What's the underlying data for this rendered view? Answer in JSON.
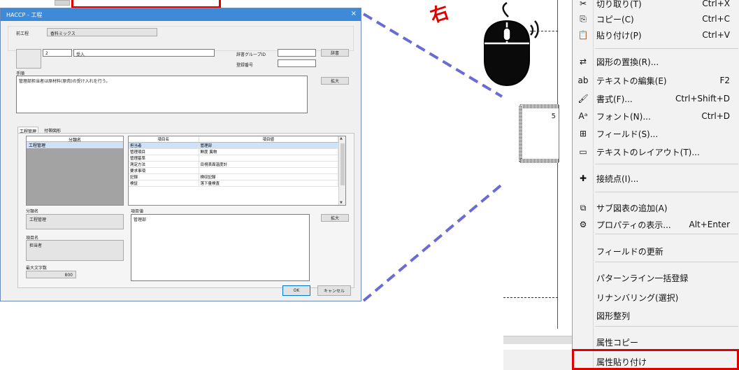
{
  "dialog": {
    "title": "HACCP - 工程",
    "close": "×",
    "prev_process_label": "前工程",
    "prev_process_value": "香料ミックス",
    "process_no": "2",
    "process_name": "受入",
    "dict_group_label": "辞書グループID",
    "register_no_label": "登録番号",
    "dictionary_button": "辞書",
    "procedure_label": "手順",
    "procedure_text": "管理部担当者は原材料(原肉)の受け入れを行う。",
    "expand_button": "拡大",
    "tabs": [
      "工程管理",
      "付帯図形"
    ],
    "class_list_header": "分類名",
    "class_list_items": [
      "工程管理"
    ],
    "table_headers": [
      "項目名",
      "項目値"
    ],
    "table_rows": [
      [
        "担当者",
        "管理部"
      ],
      [
        "管理項目",
        "鮮度 異物"
      ],
      [
        "管理基準",
        ""
      ],
      [
        "測定方法",
        "目視表面温度計"
      ],
      [
        "要求事項",
        ""
      ],
      [
        "記録",
        "検収記録"
      ],
      [
        "検証",
        "落下量検査"
      ]
    ],
    "class_name_label": "分類名",
    "class_name_value": "工程管理",
    "item_name_label": "項目名",
    "item_name_value": "担当者",
    "max_chars_label": "最大文字数",
    "max_chars_value": "800",
    "item_value_label": "項目値",
    "item_value_text": "管理部",
    "ok_button": "OK",
    "cancel_button": "キャンセル"
  },
  "canvas": {
    "shape_number": "5",
    "red_mark_text": "右"
  },
  "context_menu": {
    "items": [
      {
        "icon": "scissors-icon",
        "glyph": "✂",
        "label": "切り取り(T)",
        "shortcut": "Ctrl+X"
      },
      {
        "icon": "copy-icon",
        "glyph": "⎘",
        "label": "コピー(C)",
        "shortcut": "Ctrl+C"
      },
      {
        "icon": "paste-icon",
        "glyph": "📋",
        "label": "貼り付け(P)",
        "shortcut": "Ctrl+V"
      },
      {
        "icon": "replace-shape-icon",
        "glyph": "⇄",
        "label": "図形の置換(R)...",
        "shortcut": ""
      },
      {
        "icon": "edit-text-icon",
        "glyph": "ab",
        "label": "テキストの編集(E)",
        "shortcut": "F2"
      },
      {
        "icon": "format-icon",
        "glyph": "🖌",
        "label": "書式(F)...",
        "shortcut": "Ctrl+Shift+D"
      },
      {
        "icon": "font-icon",
        "glyph": "Aᵃ",
        "label": "フォント(N)...",
        "shortcut": "Ctrl+D"
      },
      {
        "icon": "field-icon",
        "glyph": "⊞",
        "label": "フィールド(S)...",
        "shortcut": ""
      },
      {
        "icon": "text-layout-icon",
        "glyph": "▭",
        "label": "テキストのレイアウト(T)...",
        "shortcut": ""
      },
      {
        "icon": "connection-point-icon",
        "glyph": "✚",
        "label": "接続点(I)...",
        "shortcut": ""
      },
      {
        "icon": "add-subdiagram-icon",
        "glyph": "⧉",
        "label": "サブ図表の追加(A)",
        "shortcut": ""
      },
      {
        "icon": "properties-icon",
        "glyph": "⚙",
        "label": "プロパティの表示...",
        "shortcut": "Alt+Enter"
      },
      {
        "icon": "",
        "glyph": "",
        "label": "フィールドの更新",
        "shortcut": ""
      },
      {
        "icon": "",
        "glyph": "",
        "label": "パターンライン一括登録",
        "shortcut": ""
      },
      {
        "icon": "",
        "glyph": "",
        "label": "リナンバリング(選択)",
        "shortcut": ""
      },
      {
        "icon": "",
        "glyph": "",
        "label": "図形整列",
        "shortcut": ""
      },
      {
        "icon": "",
        "glyph": "",
        "label": "属性コピー",
        "shortcut": ""
      },
      {
        "icon": "",
        "glyph": "",
        "label": "属性貼り付け",
        "shortcut": ""
      }
    ]
  },
  "colors": {
    "highlight_red": "#e00000",
    "callout_line": "#6b6bd6",
    "titlebar_blue": "#3f8ad6"
  }
}
